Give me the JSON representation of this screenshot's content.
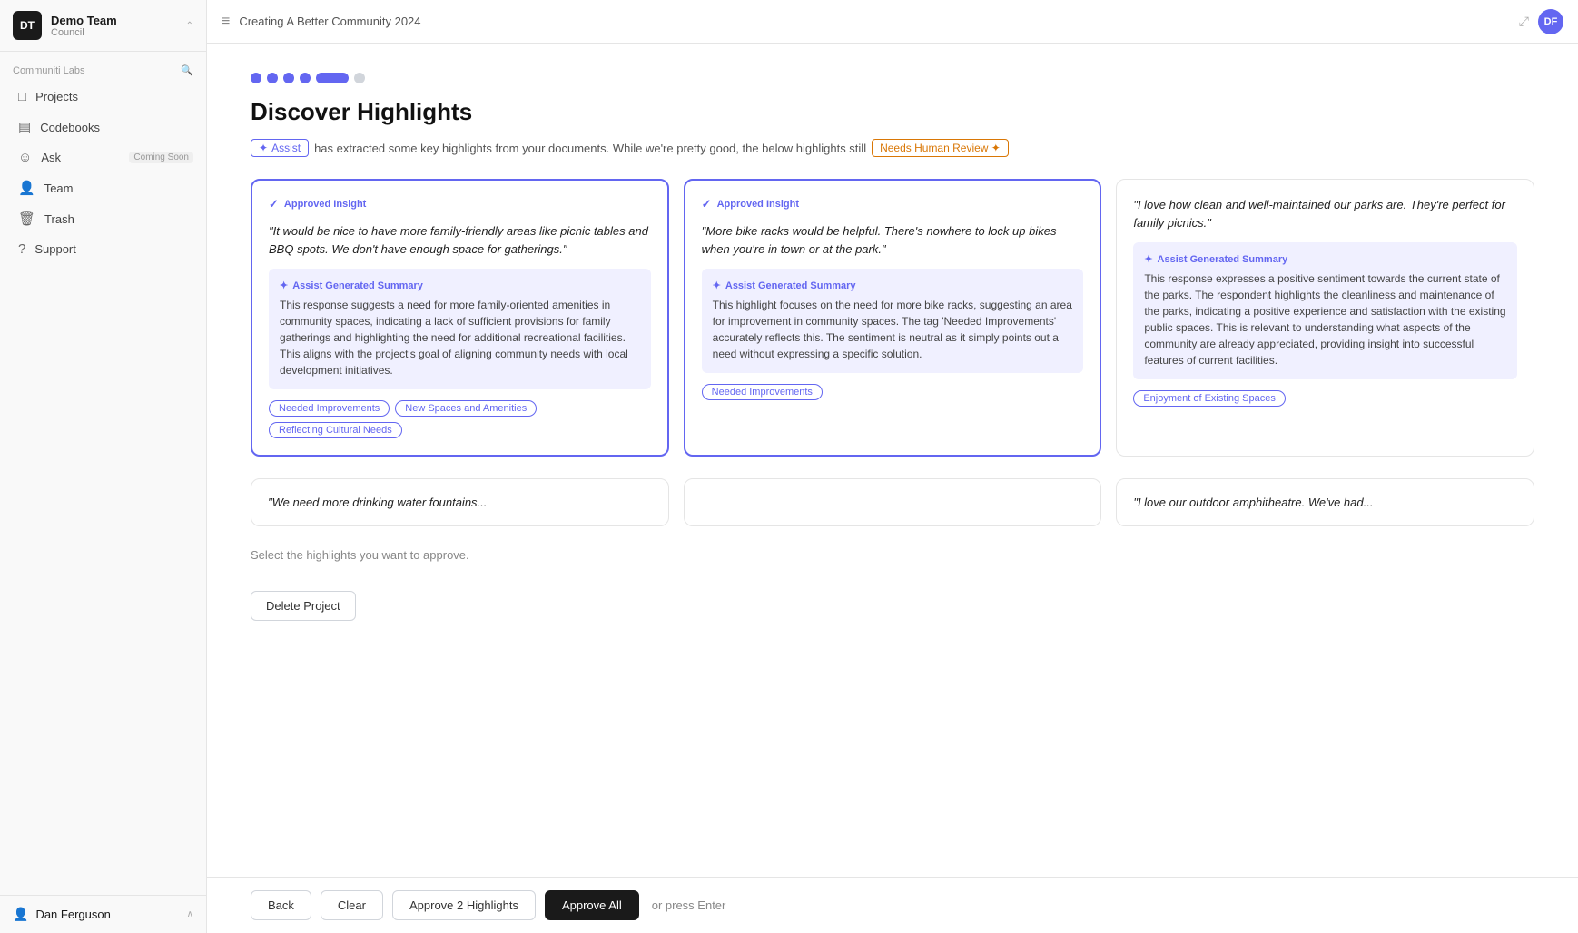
{
  "sidebar": {
    "logo_text": "DT",
    "app_name": "Demo Team",
    "app_sub": "Council",
    "section_label": "Communiti Labs",
    "nav_items": [
      {
        "id": "projects",
        "label": "Projects",
        "icon": "📁"
      },
      {
        "id": "codebooks",
        "label": "Codebooks",
        "icon": "📋"
      },
      {
        "id": "ask",
        "label": "Ask",
        "icon": "🙋",
        "badge": "Coming Soon"
      },
      {
        "id": "team",
        "label": "Team",
        "icon": "👥"
      },
      {
        "id": "trash",
        "label": "Trash",
        "icon": "🗑️"
      },
      {
        "id": "support",
        "label": "Support",
        "icon": "❓"
      }
    ],
    "user_name": "Dan Ferguson"
  },
  "topbar": {
    "title": "Creating A Better Community 2024",
    "avatar_initials": "DF"
  },
  "page": {
    "heading": "Discover Highlights",
    "assist_label": "Assist ✦",
    "assist_text": "has extracted some key highlights from your documents. While we're pretty good, the below highlights still",
    "needs_review_label": "Needs Human Review ✦",
    "progress_dots": [
      "filled",
      "filled",
      "filled",
      "filled",
      "active",
      "empty"
    ]
  },
  "cards": [
    {
      "id": "card1",
      "approved": true,
      "badge": "Approved Insight",
      "quote": "\"It would be nice to have more family-friendly areas like picnic tables and BBQ spots. We don't have enough space for gatherings.\"",
      "summary_title": "Assist Generated Summary",
      "summary_text": "This response suggests a need for more family-oriented amenities in community spaces, indicating a lack of sufficient provisions for family gatherings and highlighting the need for additional recreational facilities. This aligns with the project's goal of aligning community needs with local development initiatives.",
      "tags": [
        "Needed Improvements",
        "New Spaces and Amenities",
        "Reflecting Cultural Needs"
      ]
    },
    {
      "id": "card2",
      "approved": true,
      "badge": "Approved Insight",
      "quote": "\"More bike racks would be helpful. There's nowhere to lock up bikes when you're in town or at the park.\"",
      "summary_title": "Assist Generated Summary",
      "summary_text": "This highlight focuses on the need for more bike racks, suggesting an area for improvement in community spaces. The tag 'Needed Improvements' accurately reflects this. The sentiment is neutral as it simply points out a need without expressing a specific solution.",
      "tags": [
        "Needed Improvements"
      ]
    },
    {
      "id": "card3",
      "approved": false,
      "badge": "",
      "quote": "\"I love how clean and well-maintained our parks are. They're perfect for family picnics.\"",
      "summary_title": "Assist Generated Summary",
      "summary_text": "This response expresses a positive sentiment towards the current state of the parks. The respondent highlights the cleanliness and maintenance of the parks, indicating a positive experience and satisfaction with the existing public spaces. This is relevant to understanding what aspects of the community are already appreciated, providing insight into successful features of current facilities.",
      "tags": [
        "Enjoyment of Existing Spaces"
      ]
    }
  ],
  "bottom_cards": [
    {
      "id": "bcard1",
      "quote": "\"We need more drinking water fountains..."
    },
    {
      "id": "bcard2",
      "quote": ""
    },
    {
      "id": "bcard3",
      "quote": "\"I love our outdoor amphitheatre. We've had..."
    }
  ],
  "footer": {
    "select_hint": "Select the highlights you want to approve.",
    "back_label": "Back",
    "clear_label": "Clear",
    "approve_highlights_label": "Approve 2 Highlights",
    "approve_all_label": "Approve All",
    "press_enter_text": "or press Enter"
  },
  "delete": {
    "label": "Delete Project"
  }
}
